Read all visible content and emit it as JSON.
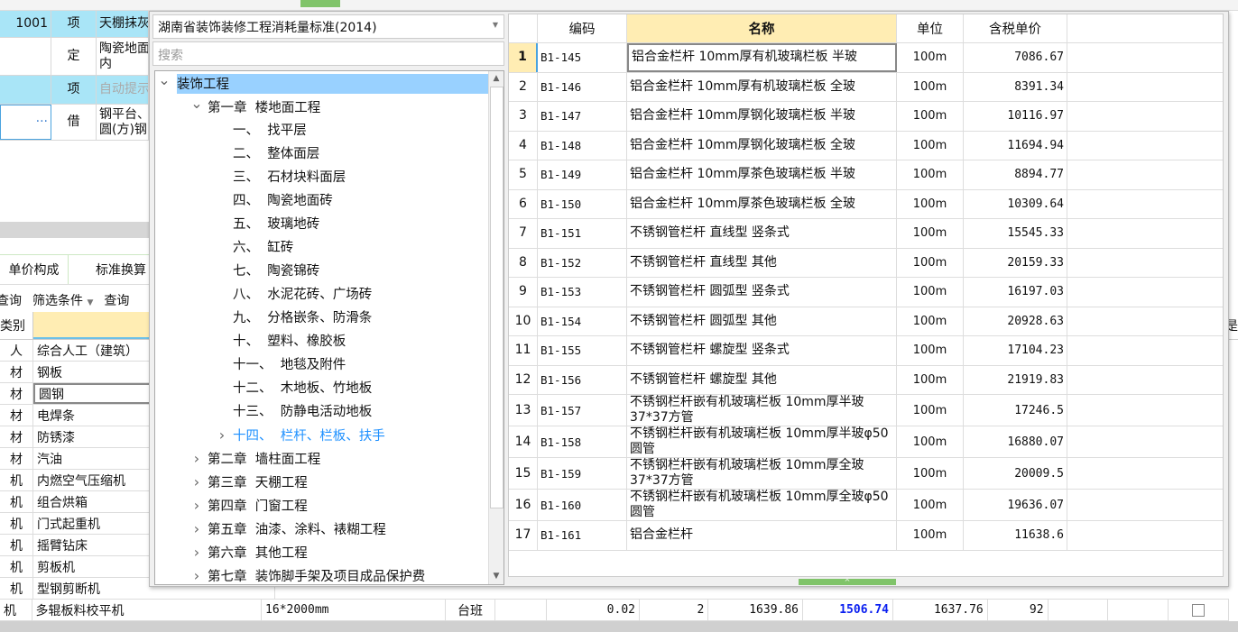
{
  "background": {
    "top_rows": [
      {
        "code": "1001",
        "type": "项",
        "name": "天棚抹灰"
      },
      {
        "code": "",
        "type": "定",
        "name": "陶瓷地面\n内"
      },
      {
        "code": "",
        "type": "项",
        "name": "自动提示"
      },
      {
        "code": "···",
        "type": "借",
        "name": "钢平台、\n圆(方)钢"
      }
    ],
    "tabs": [
      "单价构成",
      "标准换算"
    ],
    "toolbar": {
      "query": "查询",
      "filter": "筛选条件",
      "query2": "查询"
    },
    "header": {
      "category": "类别",
      "right_col": "是"
    },
    "rows": [
      {
        "cat": "人",
        "name": "综合人工（建筑）"
      },
      {
        "cat": "材",
        "name": "钢板"
      },
      {
        "cat": "材",
        "name": "圆钢"
      },
      {
        "cat": "材",
        "name": "电焊条"
      },
      {
        "cat": "材",
        "name": "防锈漆"
      },
      {
        "cat": "材",
        "name": "汽油"
      },
      {
        "cat": "机",
        "name": "内燃空气压缩机"
      },
      {
        "cat": "机",
        "name": "组合烘箱"
      },
      {
        "cat": "机",
        "name": "门式起重机"
      },
      {
        "cat": "机",
        "name": "摇臂钻床"
      },
      {
        "cat": "机",
        "name": "剪板机"
      },
      {
        "cat": "机",
        "name": "型钢剪断机"
      }
    ],
    "last_row": {
      "cat": "机",
      "name": "多辊板料校平机",
      "spec": "16*2000mm",
      "unit": "台班",
      "qty": "0.02",
      "n": "2",
      "p1": "1639.86",
      "p2": "1506.74",
      "p3": "1637.76",
      "pct": "92"
    }
  },
  "popup": {
    "library": "湖南省装饰装修工程消耗量标准(2014)",
    "search_placeholder": "搜索",
    "tree": [
      {
        "label": "装饰工程",
        "level": 0,
        "state": "expanded",
        "selected": true
      },
      {
        "label": "第一章  楼地面工程",
        "level": 1,
        "state": "expanded"
      },
      {
        "label": "一、  找平层",
        "level": 2
      },
      {
        "label": "二、  整体面层",
        "level": 2
      },
      {
        "label": "三、  石材块料面层",
        "level": 2
      },
      {
        "label": "四、  陶瓷地面砖",
        "level": 2
      },
      {
        "label": "五、  玻璃地砖",
        "level": 2
      },
      {
        "label": "六、  缸砖",
        "level": 2
      },
      {
        "label": "七、  陶瓷锦砖",
        "level": 2
      },
      {
        "label": "八、  水泥花砖、广场砖",
        "level": 2
      },
      {
        "label": "九、  分格嵌条、防滑条",
        "level": 2
      },
      {
        "label": "十、  塑料、橡胶板",
        "level": 2
      },
      {
        "label": "十一、  地毯及附件",
        "level": 2
      },
      {
        "label": "十二、  木地板、竹地板",
        "level": 2
      },
      {
        "label": "十三、  防静电活动地板",
        "level": 2
      },
      {
        "label": "十四、  栏杆、栏板、扶手",
        "level": 2,
        "state": "collapsed",
        "active": true
      },
      {
        "label": "第二章  墙柱面工程",
        "level": 1,
        "state": "collapsed"
      },
      {
        "label": "第三章  天棚工程",
        "level": 1,
        "state": "collapsed"
      },
      {
        "label": "第四章  门窗工程",
        "level": 1,
        "state": "collapsed"
      },
      {
        "label": "第五章  油漆、涂料、裱糊工程",
        "level": 1,
        "state": "collapsed"
      },
      {
        "label": "第六章  其他工程",
        "level": 1,
        "state": "collapsed"
      },
      {
        "label": "第七章  装饰脚手架及项目成品保护费",
        "level": 1,
        "state": "collapsed"
      }
    ],
    "columns": [
      "",
      "编码",
      "名称",
      "单位",
      "含税单价"
    ],
    "rows": [
      [
        "1",
        "B1-145",
        "铝合金栏杆 10mm厚有机玻璃栏板 半玻",
        "100m",
        "7086.67"
      ],
      [
        "2",
        "B1-146",
        "铝合金栏杆 10mm厚有机玻璃栏板 全玻",
        "100m",
        "8391.34"
      ],
      [
        "3",
        "B1-147",
        "铝合金栏杆 10mm厚钢化玻璃栏板 半玻",
        "100m",
        "10116.97"
      ],
      [
        "4",
        "B1-148",
        "铝合金栏杆 10mm厚钢化玻璃栏板 全玻",
        "100m",
        "11694.94"
      ],
      [
        "5",
        "B1-149",
        "铝合金栏杆 10mm厚茶色玻璃栏板 半玻",
        "100m",
        "8894.77"
      ],
      [
        "6",
        "B1-150",
        "铝合金栏杆 10mm厚茶色玻璃栏板 全玻",
        "100m",
        "10309.64"
      ],
      [
        "7",
        "B1-151",
        "不锈钢管栏杆 直线型 竖条式",
        "100m",
        "15545.33"
      ],
      [
        "8",
        "B1-152",
        "不锈钢管栏杆 直线型 其他",
        "100m",
        "20159.33"
      ],
      [
        "9",
        "B1-153",
        "不锈钢管栏杆 圆弧型 竖条式",
        "100m",
        "16197.03"
      ],
      [
        "10",
        "B1-154",
        "不锈钢管栏杆 圆弧型 其他",
        "100m",
        "20928.63"
      ],
      [
        "11",
        "B1-155",
        "不锈钢管栏杆 螺旋型 竖条式",
        "100m",
        "17104.23"
      ],
      [
        "12",
        "B1-156",
        "不锈钢管栏杆 螺旋型 其他",
        "100m",
        "21919.83"
      ],
      [
        "13",
        "B1-157",
        "不锈钢栏杆嵌有机玻璃栏板 10mm厚半玻37*37方管",
        "100m",
        "17246.5"
      ],
      [
        "14",
        "B1-158",
        "不锈钢栏杆嵌有机玻璃栏板 10mm厚半玻φ50圆管",
        "100m",
        "16880.07"
      ],
      [
        "15",
        "B1-159",
        "不锈钢栏杆嵌有机玻璃栏板 10mm厚全玻37*37方管",
        "100m",
        "20009.5"
      ],
      [
        "16",
        "B1-160",
        "不锈钢栏杆嵌有机玻璃栏板 10mm厚全玻φ50圆管",
        "100m",
        "19636.07"
      ],
      [
        "17",
        "B1-161",
        "铝合金栏杆",
        "100m",
        "11638.6"
      ]
    ]
  },
  "colors": {
    "accent": "#1e90ff",
    "selection": "#99d1ff",
    "header_yellow": "#ffedb3",
    "row_blue": "#a9e5f7",
    "green": "#80c46a"
  }
}
